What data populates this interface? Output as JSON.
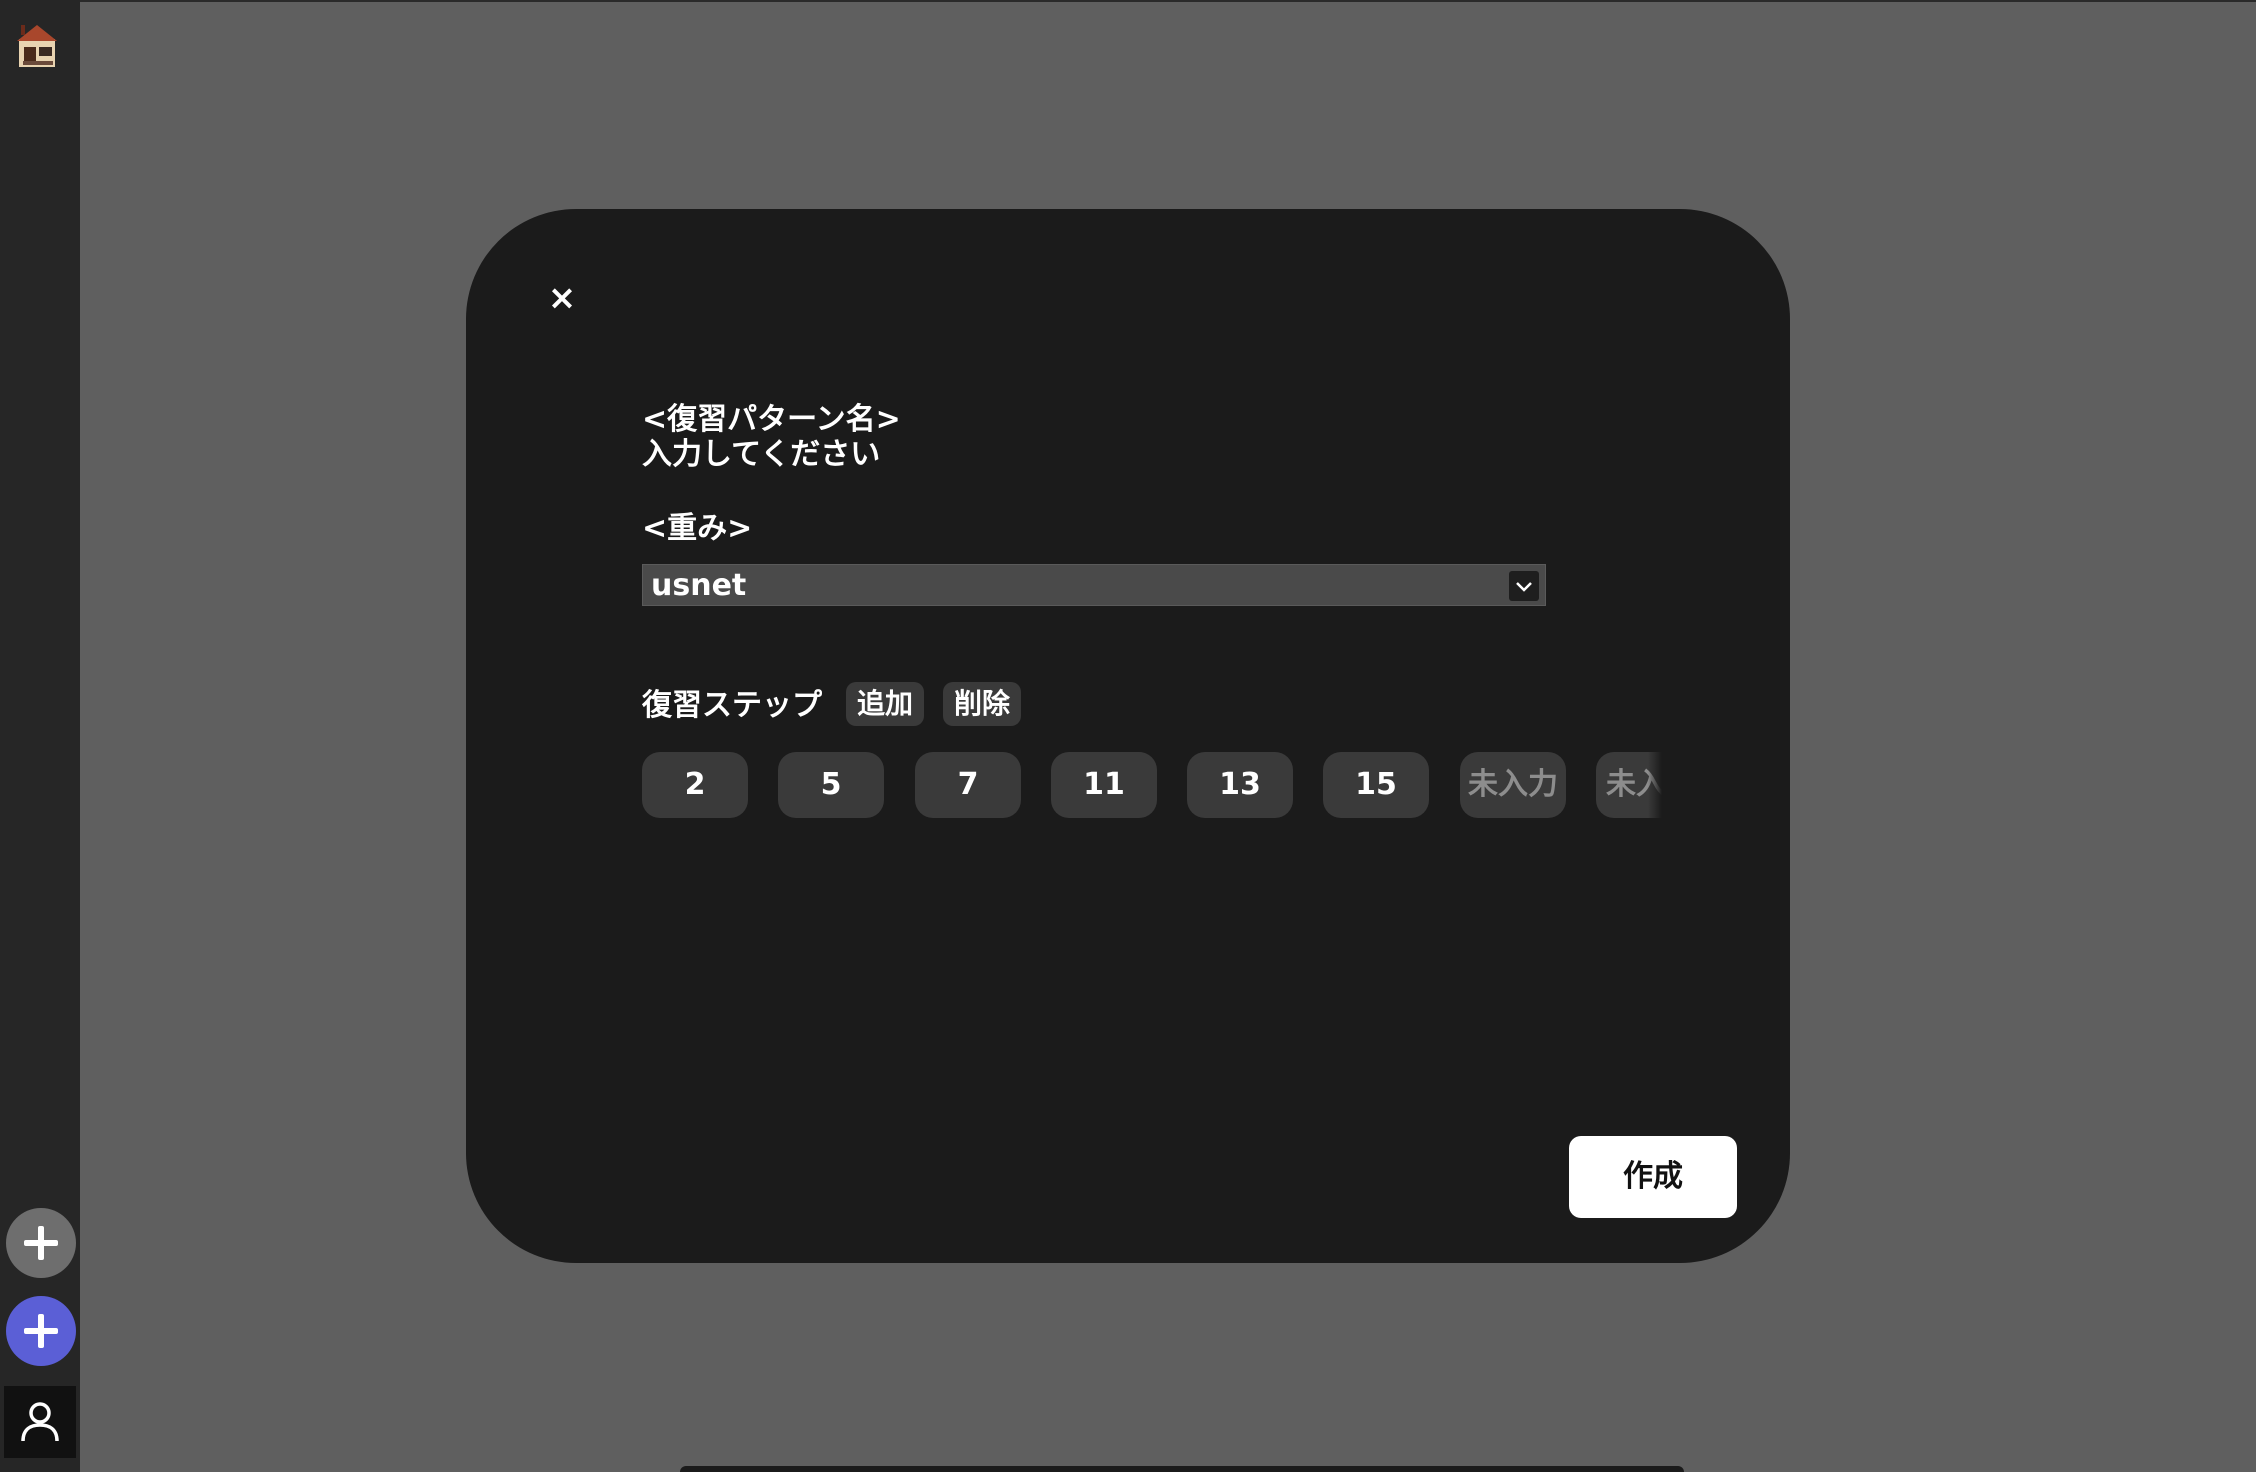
{
  "modal": {
    "close_label": "×",
    "pattern_name_label": "<復習パターン名>",
    "pattern_name_placeholder": "入力してください",
    "weight_label": "<重み>",
    "weight_select": {
      "value": "usnet"
    },
    "steps_label": "復習ステップ",
    "add_label": "追加",
    "delete_label": "削除",
    "steps": [
      {
        "value": "2"
      },
      {
        "value": "5"
      },
      {
        "value": "7"
      },
      {
        "value": "11"
      },
      {
        "value": "13"
      },
      {
        "value": "15"
      },
      {
        "value": "未入力"
      },
      {
        "value": "未入力"
      }
    ],
    "create_label": "作成"
  },
  "sidebar": {
    "icons": [
      "house-icon",
      "plus-icon",
      "plus-icon",
      "user-icon"
    ]
  },
  "colors": {
    "background": "#5f5f5f",
    "sidebar": "#262626",
    "modal": "#1b1b1b",
    "accent": "#5b5fd6",
    "chip": "#3a3a3a"
  }
}
